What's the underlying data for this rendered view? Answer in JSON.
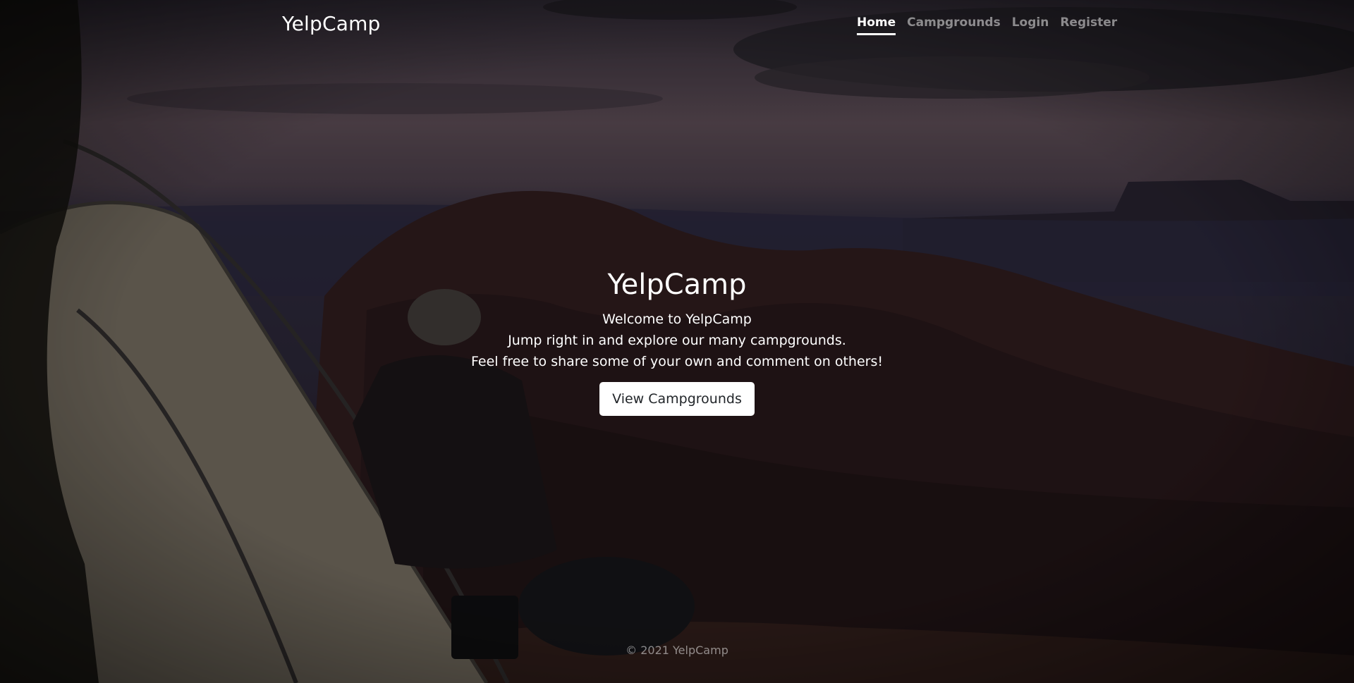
{
  "navbar": {
    "brand": "YelpCamp",
    "links": [
      {
        "label": "Home",
        "active": true
      },
      {
        "label": "Campgrounds",
        "active": false
      },
      {
        "label": "Login",
        "active": false
      },
      {
        "label": "Register",
        "active": false
      }
    ]
  },
  "hero": {
    "title": "YelpCamp",
    "lines": [
      "Welcome to YelpCamp",
      "Jump right in and explore our many campgrounds.",
      "Feel free to share some of your own and comment on others!"
    ],
    "button_label": "View Campgrounds"
  },
  "footer": {
    "text": "© 2021 YelpCamp"
  }
}
